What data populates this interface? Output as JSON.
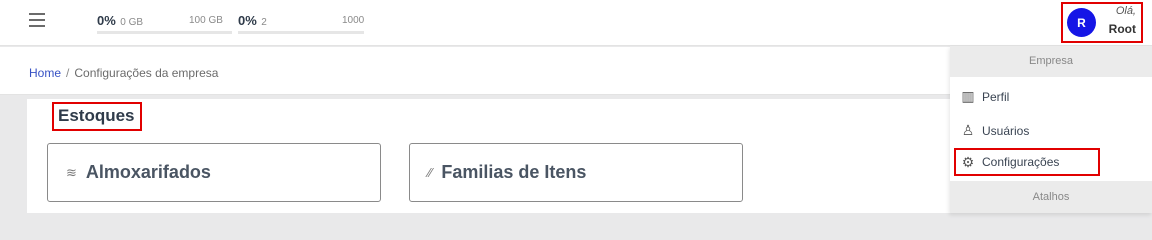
{
  "header": {
    "storage": {
      "percent": "0%",
      "used": "0 GB",
      "max": "100 GB",
      "fill": 0
    },
    "users": {
      "percent": "0%",
      "used": "2",
      "max": "1000",
      "fill": 0
    },
    "user": {
      "initial": "R",
      "greeting": "Olá,",
      "name": "Root"
    }
  },
  "breadcrumb": {
    "home": "Home",
    "separator": "/",
    "current": "Configurações da empresa"
  },
  "section": {
    "title": "Estoques",
    "cards": [
      {
        "label": "Almoxarifados",
        "icon": "layers-icon"
      },
      {
        "label": "Familias de Itens",
        "icon": "wand-icon"
      }
    ]
  },
  "menu": {
    "header": "Empresa",
    "items": [
      {
        "label": "Perfil",
        "icon": "chart-icon"
      },
      {
        "label": "Usuários",
        "icon": "user-icon"
      },
      {
        "label": "Configurações",
        "icon": "gear-icon"
      }
    ],
    "shortcuts_header": "Atalhos"
  },
  "colors": {
    "highlight": "#e10000",
    "avatar": "#1515e6",
    "link": "#3651c4"
  }
}
